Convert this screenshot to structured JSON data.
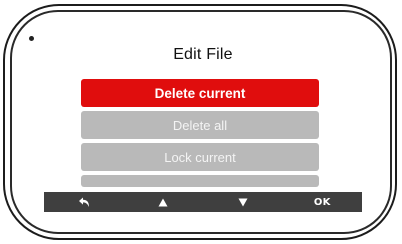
{
  "screen": {
    "title": "Edit File",
    "menu_items": [
      {
        "label": "Delete current",
        "selected": true
      },
      {
        "label": "Delete all",
        "selected": false
      },
      {
        "label": "Lock current",
        "selected": false
      },
      {
        "label": "",
        "selected": false
      }
    ]
  },
  "softkeys": {
    "back_icon": "back-arrow-icon",
    "up_icon": "triangle-up-icon",
    "down_icon": "triangle-down-icon",
    "ok_label": "OK"
  },
  "colors": {
    "selected_item": "#e00d0d",
    "unselected_item": "#b9b9b9",
    "softkey_bar": "#3f3f3f"
  }
}
